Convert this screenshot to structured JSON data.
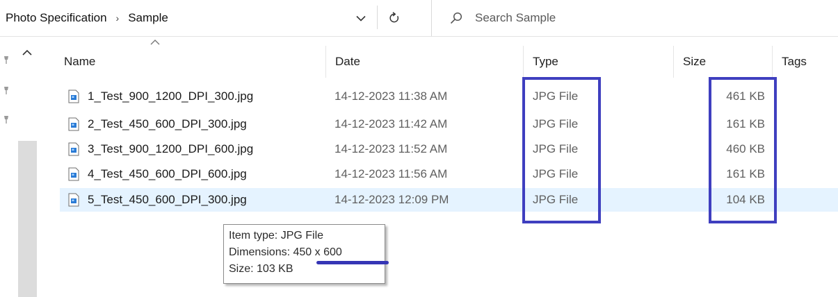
{
  "breadcrumb": {
    "root": "Photo Specification",
    "current": "Sample"
  },
  "search": {
    "placeholder": "Search Sample"
  },
  "columns": {
    "name": "Name",
    "date": "Date",
    "type": "Type",
    "size": "Size",
    "tags": "Tags"
  },
  "files": [
    {
      "name": "1_Test_900_1200_DPI_300.jpg",
      "date": "14-12-2023 11:38 AM",
      "type": "JPG File",
      "size": "461 KB"
    },
    {
      "name": "2_Test_450_600_DPI_300.jpg",
      "date": "14-12-2023 11:42 AM",
      "type": "JPG File",
      "size": "161 KB"
    },
    {
      "name": "3_Test_900_1200_DPI_600.jpg",
      "date": "14-12-2023 11:52 AM",
      "type": "JPG File",
      "size": "460 KB"
    },
    {
      "name": "4_Test_450_600_DPI_600.jpg",
      "date": "14-12-2023 11:56 AM",
      "type": "JPG File",
      "size": "161 KB"
    },
    {
      "name": "5_Test_450_600_DPI_300.jpg",
      "date": "14-12-2023 12:09 PM",
      "type": "JPG File",
      "size": "104 KB"
    }
  ],
  "tooltip": {
    "item_type": "Item type: JPG File",
    "dimensions_label": "Dimensions: ",
    "dimensions_value": "450 x 600",
    "size": "Size: 103 KB"
  },
  "colors": {
    "selection": "#e5f3ff",
    "annotation": "#3f3fbf"
  },
  "icons": {
    "chevron": "chevron-down-icon",
    "refresh": "refresh-icon",
    "search": "search-icon",
    "nav_up": "chevron-up-icon",
    "file": "jpg-file-icon",
    "pin": "pin-icon"
  }
}
